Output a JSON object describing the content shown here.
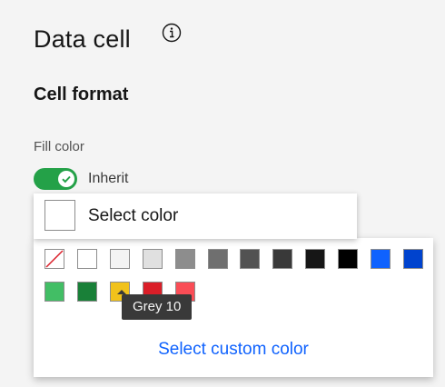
{
  "panel": {
    "title": "Data cell",
    "info_icon": "info-icon"
  },
  "cell_format": {
    "title": "Cell format",
    "fill_color_label": "Fill color",
    "inherit_toggle": {
      "label": "Inherit",
      "on": true,
      "color": "#24a148"
    },
    "select": {
      "label": "Select color"
    },
    "swatches": [
      {
        "name": "none",
        "color": "#ffffff",
        "slash": true
      },
      {
        "name": "white",
        "color": "#ffffff"
      },
      {
        "name": "grey-10",
        "color": "#f4f4f4"
      },
      {
        "name": "grey-20",
        "color": "#e0e0e0"
      },
      {
        "name": "grey-40",
        "color": "#8d8d8d"
      },
      {
        "name": "grey-60",
        "color": "#6f6f6f"
      },
      {
        "name": "grey-70",
        "color": "#525252"
      },
      {
        "name": "grey-80",
        "color": "#393939"
      },
      {
        "name": "grey-90",
        "color": "#161616"
      },
      {
        "name": "black",
        "color": "#000000"
      },
      {
        "name": "blue-60",
        "color": "#0f62fe"
      },
      {
        "name": "blue-70",
        "color": "#0043ce"
      },
      {
        "name": "green-40",
        "color": "#42be65"
      },
      {
        "name": "green-60",
        "color": "#198038"
      },
      {
        "name": "yellow-30",
        "color": "#f1c21b"
      },
      {
        "name": "red-60",
        "color": "#da1e28"
      },
      {
        "name": "red-50",
        "color": "#fa4d56"
      }
    ],
    "tooltip": "Grey 10",
    "custom_color_link": "Select custom color"
  }
}
